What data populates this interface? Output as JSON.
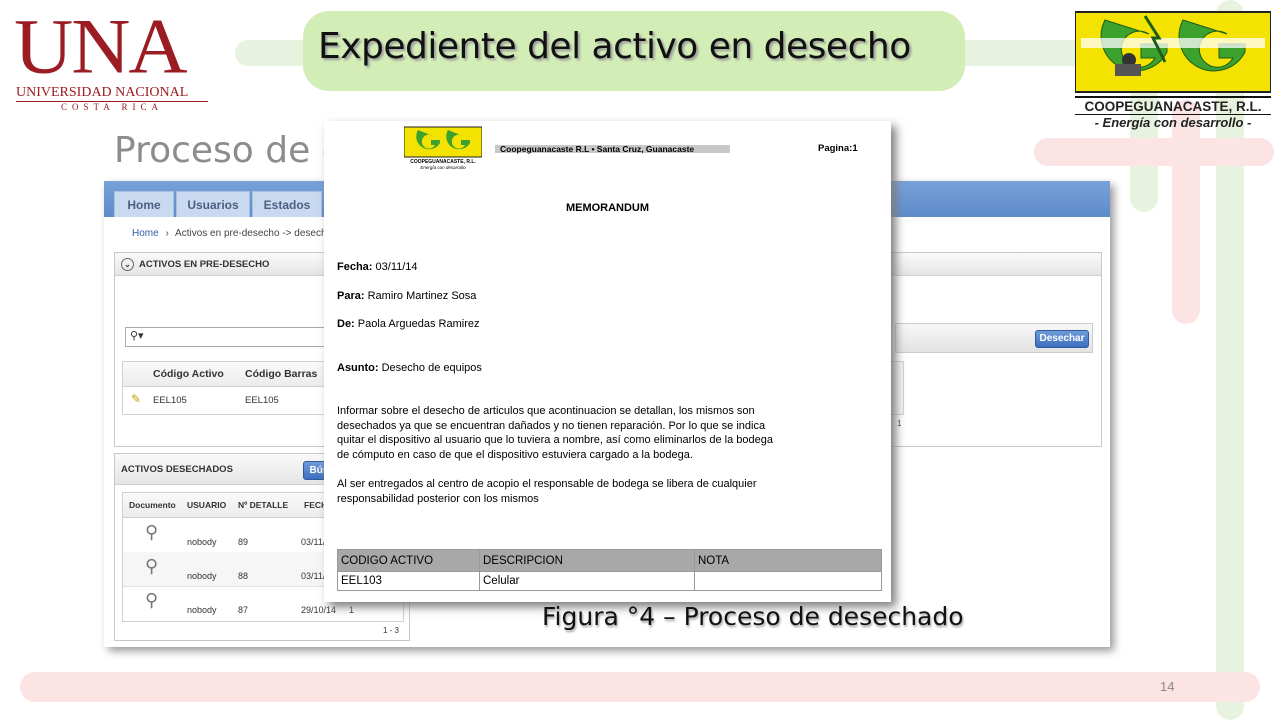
{
  "slide": {
    "title": "Expediente del activo en desecho",
    "heading": "Proceso de d",
    "caption": "Figura °4 – Proceso de desechado",
    "page_number": "14",
    "colors": {
      "una_red": "#9b1c23",
      "title_pill": "#d3edb6",
      "coope_green": "#3da12d",
      "coope_yellow": "#f4e300",
      "apex_blue": "#5d8bcb"
    }
  },
  "una_logo": {
    "letters": "UNA",
    "line1": "UNIVERSIDAD NACIONAL",
    "line2": "COSTA RICA"
  },
  "coope_logo": {
    "name": "COOPEGUANACASTE, R.L.",
    "tagline": "- Energía con desarrollo -"
  },
  "app": {
    "tabs": [
      "Home",
      "Usuarios",
      "Estados"
    ],
    "breadcrumb": {
      "home": "Home",
      "separator": "›",
      "current": "Activos en pre-desecho -> desecho"
    },
    "region1": {
      "title": "ACTIVOS EN PRE-DESECHO",
      "search_placeholder": "",
      "columns": [
        "Código Activo",
        "Código Barras"
      ],
      "rows": [
        {
          "codigo_activo": "EEL105",
          "codigo_barras": "EEL105"
        }
      ],
      "desechar_button": "Desechar",
      "pagination_fragment": "1"
    },
    "region2": {
      "title": "ACTIVOS DESECHADOS",
      "button": "Bús",
      "columns": [
        "Documento",
        "USUARIO",
        "Nº DETALLE",
        "FECH"
      ],
      "rows": [
        {
          "usuario": "nobody",
          "detalle": "89",
          "fecha": "03/11/"
        },
        {
          "usuario": "nobody",
          "detalle": "88",
          "fecha": "03/11/"
        },
        {
          "usuario": "nobody",
          "detalle": "87",
          "fecha": "29/10/14",
          "extra": "1"
        }
      ],
      "pagination": "1 - 3"
    }
  },
  "memo": {
    "logo_name": "COOPEGUANACASTE, R.L.",
    "logo_tagline": "Energía con desarrollo",
    "header": "Coopeguanacaste R.L • Santa Cruz, Guanacaste",
    "page_label": "Pagina:",
    "page_value": "1",
    "title": "MEMORANDUM",
    "fecha_label": "Fecha:",
    "fecha": "03/11/14",
    "para_label": "Para:",
    "para": "Ramiro Martinez Sosa",
    "de_label": "De:",
    "de": "Paola Arguedas Ramirez",
    "asunto_label": "Asunto:",
    "asunto": "Desecho de equipos",
    "paragraph1_lines": [
      "Informar sobre el desecho de articulos que acontinuacion se detallan, los mismos son",
      "desechados ya que se encuentran dañados y no tienen reparación. Por lo que se indica",
      "quitar el dispositivo al usuario que lo tuviera a nombre, así como eliminarlos de la bodega",
      "de cómputo en caso de que el dispositivo estuviera cargado a la bodega."
    ],
    "paragraph2_lines": [
      "Al ser entregados al centro de acopio el responsable de bodega se libera de cualquier",
      "responsabilidad posterior con los mismos"
    ],
    "table_headers": [
      "CODIGO ACTIVO",
      "DESCRIPCION",
      "NOTA"
    ],
    "table_rows": [
      {
        "codigo": "EEL103",
        "descripcion": "Celular",
        "nota": ""
      }
    ]
  }
}
